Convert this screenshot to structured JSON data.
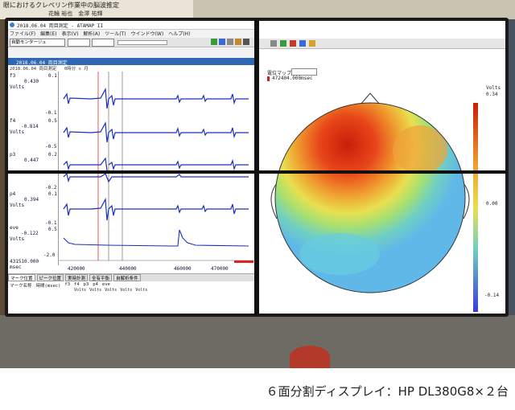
{
  "photo": {
    "poster_lines": [
      "眼におけるクレペリン作業中の脳波推定",
      "花輪 裕也　金澤 祐輝"
    ],
    "app_window": {
      "title": "2018.06.04 両目測定 - ATAMAP II",
      "menu": [
        "ファイル(F)",
        "編集(E)",
        "表示(V)",
        "解析(A)",
        "ツール(T)",
        "ウインドウ(W)",
        "ヘルプ(H)"
      ],
      "mode_select": "自動モンタージュ",
      "subwindow_title": "2018.06.04 両目測定",
      "recording_label": "2018.06.04 両目測定",
      "time_label": "0時分 s 月",
      "channels": [
        {
          "name": "f3",
          "value": "0.430",
          "unit": "Volts",
          "scale_top": "0.1",
          "scale_bottom": "-0.1"
        },
        {
          "name": "f4",
          "value": "-0.814",
          "unit": "Volts",
          "scale_top": "0.5",
          "scale_bottom": "-0.5"
        },
        {
          "name": "p3",
          "value": "0.447",
          "unit": "Volts",
          "scale_top": "0.2",
          "scale_bottom": "-0.2"
        },
        {
          "name": "p4",
          "value": "0.394",
          "unit": "Volts",
          "scale_top": "0.1",
          "scale_bottom": "-0.1"
        },
        {
          "name": "eve",
          "value": "-0.122",
          "unit": "Volts",
          "scale_top": "0.5",
          "scale_bottom": "-2.0"
        }
      ],
      "cursor_time": "431510.000",
      "cursor_unit": "msec",
      "x_ticks": [
        "420000",
        "440000",
        "460000",
        "470000"
      ],
      "tabs": [
        "マーク位置",
        "ピーク位置",
        "実時計測",
        "全有平衡",
        "自解析条件"
      ],
      "mark_header": [
        "マーク名称",
        "時間(msec)",
        "f3",
        "f4",
        "p3",
        "p4",
        "eve"
      ],
      "mark_units": [
        "Volts",
        "Volts",
        "Volts",
        "Volts",
        "Volts"
      ]
    },
    "map_window": {
      "title": "電位マップ",
      "time_stamp": "472404.000msec",
      "scale_unit": "Volts",
      "scale_max": "0.34",
      "scale_mid": "0.00",
      "scale_min": "-0.14"
    }
  },
  "caption": "６面分割ディスプレイ：HP DL380G8×２台"
}
